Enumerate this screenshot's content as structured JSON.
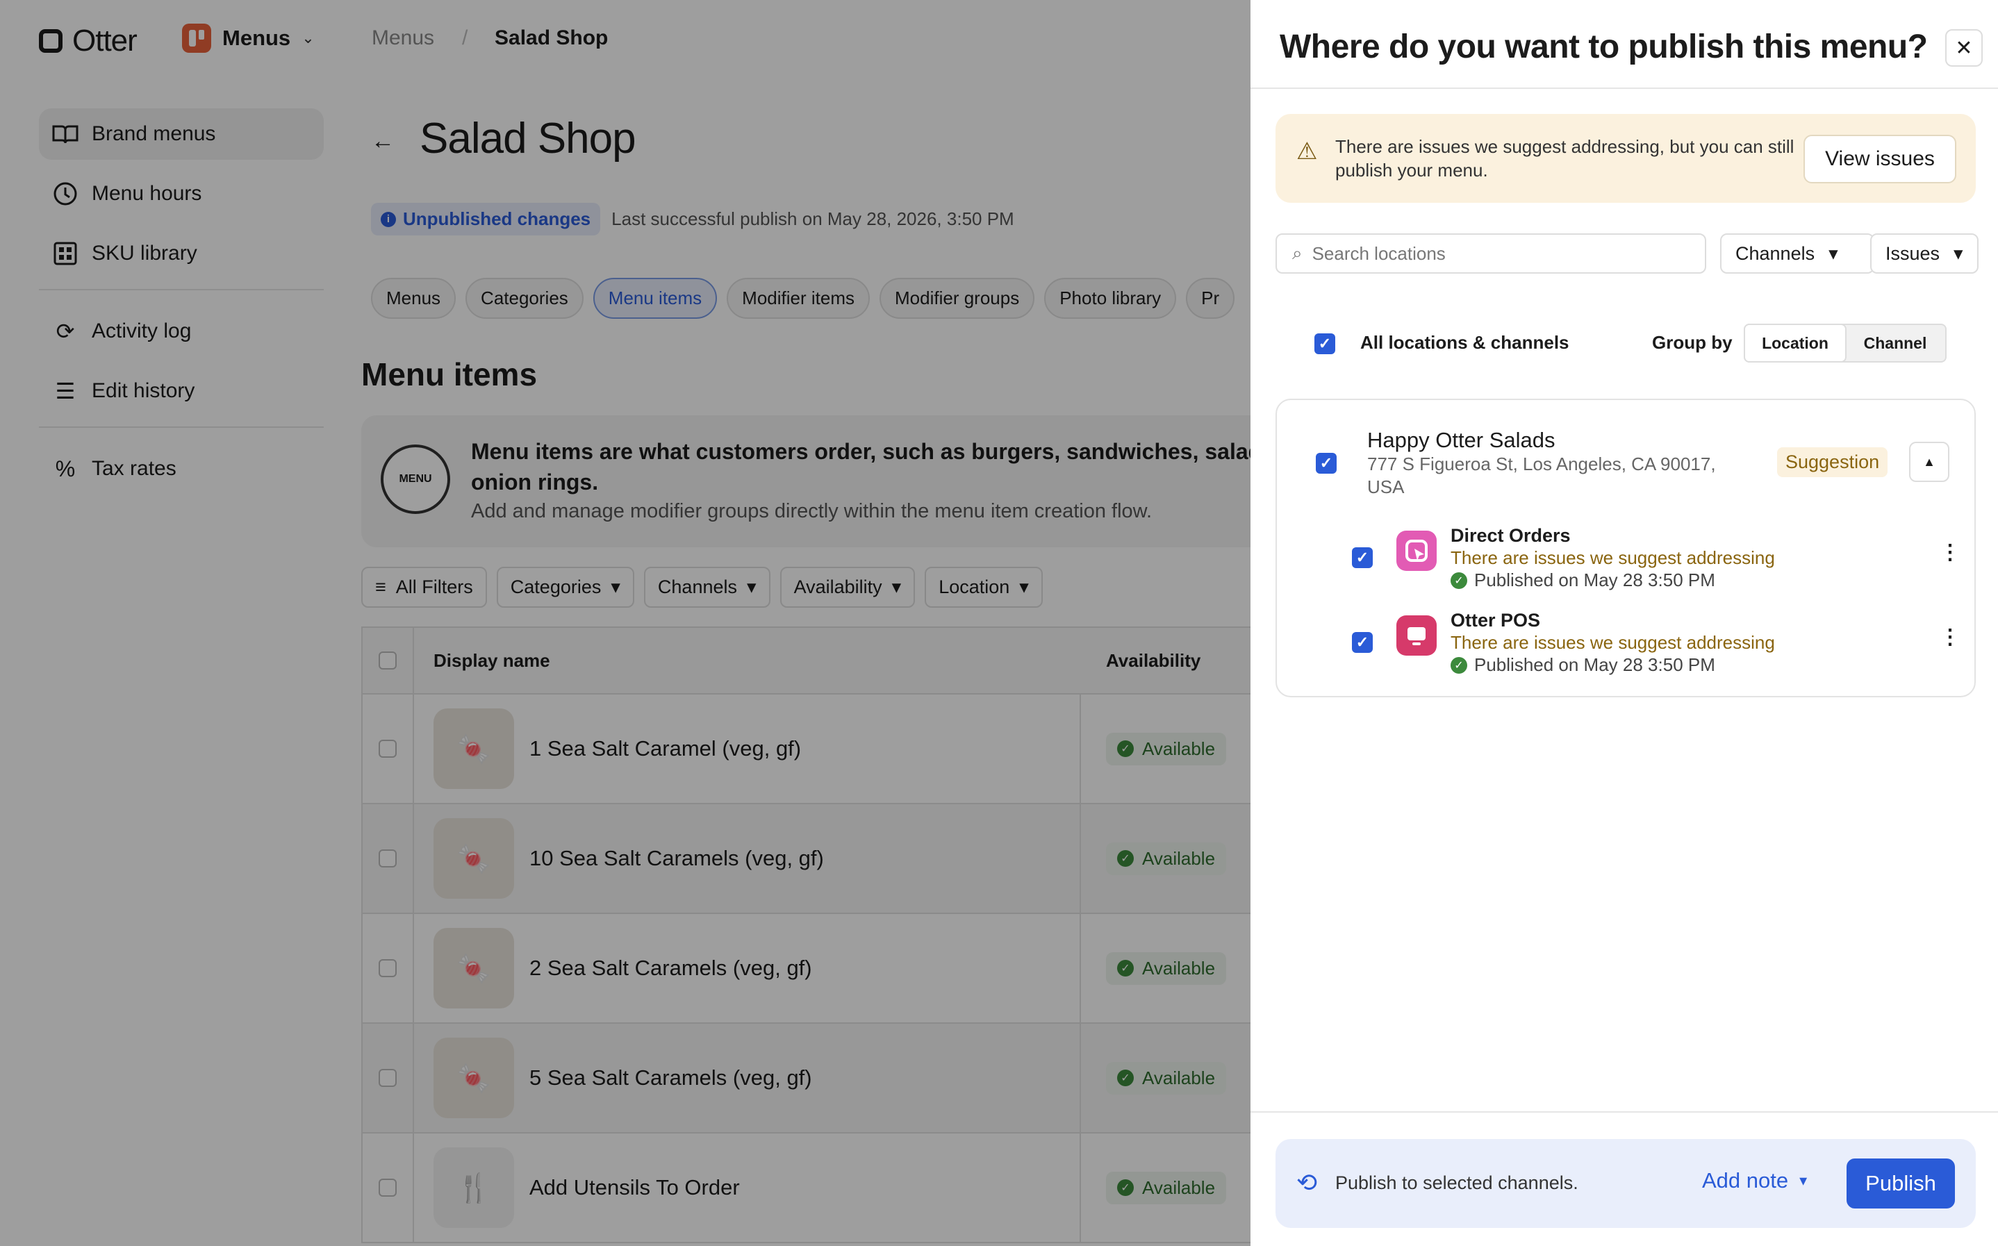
{
  "app": {
    "brand": "Otter",
    "switcher_label": "Menus"
  },
  "breadcrumb": {
    "parent": "Menus",
    "separator": "/",
    "current": "Salad Shop"
  },
  "sidebar": {
    "items": [
      {
        "label": "Brand menus",
        "icon": "book-icon"
      },
      {
        "label": "Menu hours",
        "icon": "clock-icon"
      },
      {
        "label": "SKU library",
        "icon": "grid-icon"
      },
      {
        "label": "Activity log",
        "icon": "refresh-icon"
      },
      {
        "label": "Edit history",
        "icon": "list-icon"
      },
      {
        "label": "Tax rates",
        "icon": "percent-icon"
      }
    ]
  },
  "page": {
    "title": "Salad Shop",
    "status_badge": "Unpublished changes",
    "last_publish": "Last successful publish on May 28, 2026, 3:50 PM",
    "tabs": [
      "Menus",
      "Categories",
      "Menu items",
      "Modifier items",
      "Modifier groups",
      "Photo library",
      "Pr"
    ],
    "section_title": "Menu items",
    "info_heading": "Menu items are what customers order, such as burgers, sandwiches, salads or onion rings.",
    "info_sub": "Add and manage modifier groups directly within the menu item creation flow.",
    "info_icon_text": "MENU",
    "filters": [
      "All Filters",
      "Categories",
      "Channels",
      "Availability",
      "Location"
    ],
    "table": {
      "headers": [
        "Display name",
        "Availability"
      ],
      "rows": [
        {
          "name": "1 Sea Salt Caramel (veg, gf)",
          "availability": "Available"
        },
        {
          "name": "10 Sea Salt Caramels (veg, gf)",
          "availability": "Available"
        },
        {
          "name": "2 Sea Salt Caramels (veg, gf)",
          "availability": "Available"
        },
        {
          "name": "5 Sea Salt Caramels (veg, gf)",
          "availability": "Available"
        },
        {
          "name": "Add Utensils To Order",
          "availability": "Available"
        }
      ]
    }
  },
  "drawer": {
    "title": "Where do you want to publish this menu?",
    "warning_text": "There are issues we suggest addressing, but you can still publish your menu.",
    "view_issues_label": "View issues",
    "search_placeholder": "Search locations",
    "channels_dropdown": "Channels",
    "issues_dropdown": "Issues",
    "all_label": "All locations & channels",
    "group_by_label": "Group by",
    "group_by_options": [
      "Location",
      "Channel"
    ],
    "location": {
      "name": "Happy Otter Salads",
      "address": "777 S Figueroa St, Los Angeles, CA 90017, USA",
      "tag": "Suggestion",
      "channels": [
        {
          "name": "Direct Orders",
          "warning": "There are issues we suggest addressing",
          "published": "Published on May 28 3:50 PM",
          "color": "#e25bb4"
        },
        {
          "name": "Otter POS",
          "warning": "There are issues we suggest addressing",
          "published": "Published on May 28 3:50 PM",
          "color": "#d63a6a"
        }
      ]
    },
    "footer_text": "Publish to selected channels.",
    "add_note_label": "Add note",
    "publish_label": "Publish"
  },
  "colors": {
    "accent": "#2a5bd7",
    "warning_bg": "#fbf1de",
    "success": "#3c8a3c"
  }
}
